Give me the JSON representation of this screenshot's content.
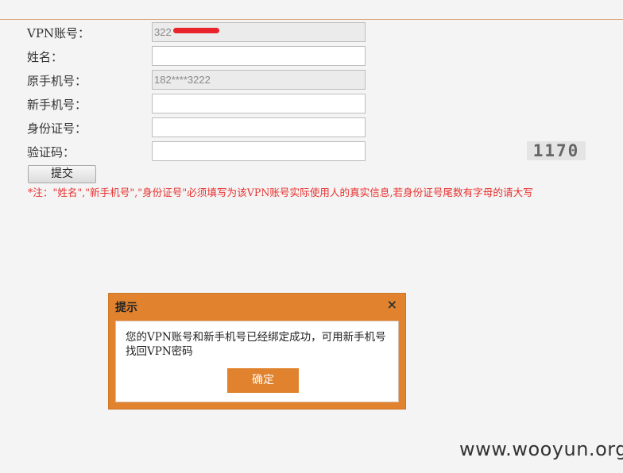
{
  "form": {
    "vpn_account": {
      "label": "VPN账号：",
      "value": "322"
    },
    "name": {
      "label": "姓名：",
      "value": ""
    },
    "old_phone": {
      "label": "原手机号：",
      "value": "182****3222"
    },
    "new_phone": {
      "label": "新手机号：",
      "value": ""
    },
    "id_number": {
      "label": "身份证号：",
      "value": ""
    },
    "captcha": {
      "label": "验证码：",
      "value": "",
      "image_text": "1170"
    },
    "submit_label": "提交",
    "note": "*注：\"姓名\",\"新手机号\",\"身份证号\"必须填写为该VPN账号实际使用人的真实信息,若身份证号尾数有字母的请大写"
  },
  "dialog": {
    "title": "提示",
    "close_glyph": "×",
    "message": "您的VPN账号和新手机号已经绑定成功，可用新手机号找回VPN密码",
    "ok_label": "确定"
  },
  "watermark": "www.wooyun.org",
  "colors": {
    "accent": "#e0822e",
    "note_red": "#e8312f",
    "redaction": "#e8232a"
  }
}
